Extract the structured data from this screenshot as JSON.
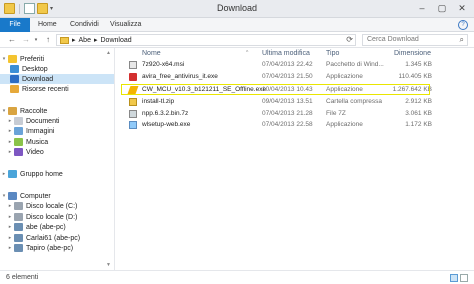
{
  "window": {
    "title": "Download"
  },
  "ribbon": {
    "tabs": [
      "File",
      "Home",
      "Condividi",
      "Visualizza"
    ]
  },
  "address": {
    "path": [
      "Abe",
      "Download"
    ],
    "search_placeholder": "Cerca Download"
  },
  "sidebar": {
    "items": [
      {
        "label": "Preferiti",
        "icon": "star-icon",
        "level": 0,
        "expand": "▾"
      },
      {
        "label": "Desktop",
        "icon": "desktop-icon",
        "level": 1
      },
      {
        "label": "Download",
        "icon": "download-folder-icon",
        "level": 1,
        "selected": true
      },
      {
        "label": "Risorse recenti",
        "icon": "recent-places-icon",
        "level": 1
      },
      {
        "label": "Raccolte",
        "icon": "libraries-icon",
        "level": 0,
        "expand": "▾"
      },
      {
        "label": "Documenti",
        "icon": "documents-icon",
        "level": 1,
        "expand": "▸"
      },
      {
        "label": "Immagini",
        "icon": "pictures-icon",
        "level": 1,
        "expand": "▸"
      },
      {
        "label": "Musica",
        "icon": "music-icon",
        "level": 1,
        "expand": "▸"
      },
      {
        "label": "Video",
        "icon": "videos-icon",
        "level": 1,
        "expand": "▸"
      },
      {
        "label": "Gruppo home",
        "icon": "homegroup-icon",
        "level": 0,
        "expand": "▸"
      },
      {
        "label": "Computer",
        "icon": "computer-icon",
        "level": 0,
        "expand": "▾"
      },
      {
        "label": "Disco locale (C:)",
        "icon": "drive-icon",
        "level": 1,
        "expand": "▸"
      },
      {
        "label": "Disco locale (D:)",
        "icon": "drive-icon",
        "level": 1,
        "expand": "▸"
      },
      {
        "label": "abe (abe-pc)",
        "icon": "network-drive-icon",
        "level": 1,
        "expand": "▸"
      },
      {
        "label": "Carlai61 (abe-pc)",
        "icon": "network-drive-icon",
        "level": 1,
        "expand": "▸"
      },
      {
        "label": "Tapiro (abe-pc)",
        "icon": "network-drive-icon",
        "level": 1,
        "expand": "▸"
      }
    ]
  },
  "columns": {
    "name": "Nome",
    "date": "Ultima modifica",
    "type": "Tipo",
    "size": "Dimensione"
  },
  "files": [
    {
      "name": "7z920-x64.msi",
      "date": "07/04/2013 22.42",
      "type": "Pacchetto di Wind...",
      "size": "1.345 KB",
      "icon": "msi-file-icon"
    },
    {
      "name": "avira_free_antivirus_it.exe",
      "date": "07/04/2013 21.50",
      "type": "Applicazione",
      "size": "110.405 KB",
      "icon": "avira-exe-icon"
    },
    {
      "name": "CW_MCU_v10.3_b121211_SE_Offline.exe",
      "date": "10/04/2013 10.43",
      "type": "Applicazione",
      "size": "1.267.642 KB",
      "icon": "codewarrior-exe-icon"
    },
    {
      "name": "install-tl.zip",
      "date": "09/04/2013 13.51",
      "type": "Cartella compressa",
      "size": "2.912 KB",
      "icon": "zip-folder-icon"
    },
    {
      "name": "npp.6.3.2.bin.7z",
      "date": "07/04/2013 21.28",
      "type": "File 7Z",
      "size": "3.061 KB",
      "icon": "archive-7z-icon"
    },
    {
      "name": "wlsetup-web.exe",
      "date": "07/04/2013 22.58",
      "type": "Applicazione",
      "size": "1.172 KB",
      "icon": "windows-live-exe-icon"
    }
  ],
  "status": {
    "count": "6 elementi"
  }
}
